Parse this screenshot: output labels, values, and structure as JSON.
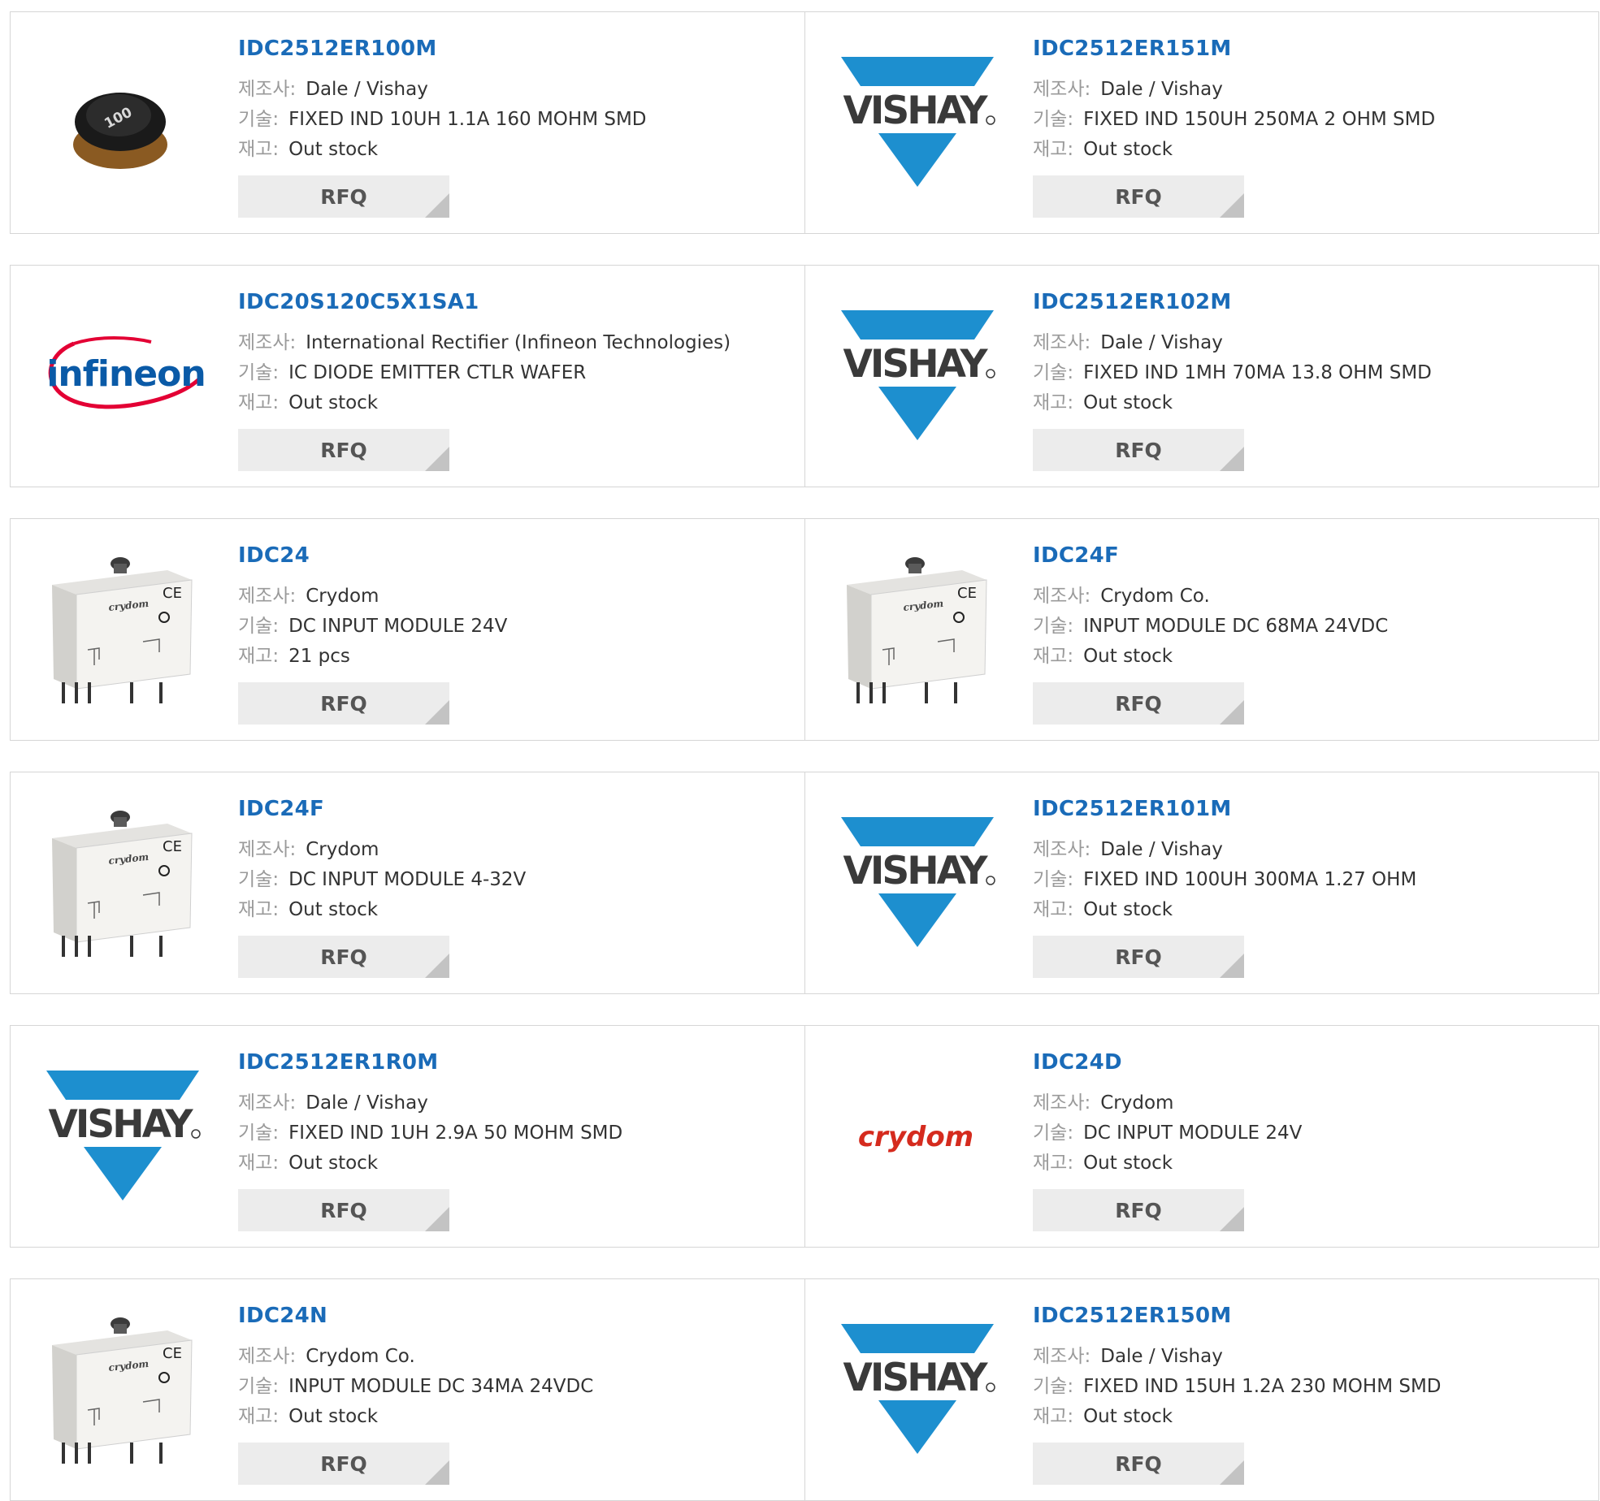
{
  "labels": {
    "manufacturer": "제조사:",
    "description": "기술:",
    "stock": "재고:"
  },
  "rfq_label": "RFQ",
  "colors": {
    "part_link": "#1a6bb8",
    "vishay_blue": "#1d8fcf",
    "crydom_red": "#d52b1e",
    "infineon_red": "#e30034",
    "infineon_blue": "#0a5aa7"
  },
  "products": [
    {
      "part": "IDC2512ER100M",
      "manufacturer": "Dale / Vishay",
      "description": "FIXED IND 10UH 1.1A 160 MOHM SMD",
      "stock": "Out stock",
      "image": "inductor-photo",
      "marking": "100"
    },
    {
      "part": "IDC2512ER151M",
      "manufacturer": "Dale / Vishay",
      "description": "FIXED IND 150UH 250MA 2 OHM SMD",
      "stock": "Out stock",
      "image": "vishay-logo",
      "logo_text": "VISHAY"
    },
    {
      "part": "IDC20S120C5X1SA1",
      "manufacturer": "International Rectifier (Infineon Technologies)",
      "description": "IC DIODE EMITTER CTLR WAFER",
      "stock": "Out stock",
      "image": "infineon-logo",
      "logo_text": "infineon"
    },
    {
      "part": "IDC2512ER102M",
      "manufacturer": "Dale / Vishay",
      "description": "FIXED IND 1MH 70MA 13.8 OHM SMD",
      "stock": "Out stock",
      "image": "vishay-logo",
      "logo_text": "VISHAY"
    },
    {
      "part": "IDC24",
      "manufacturer": "Crydom",
      "description": "DC INPUT MODULE 24V",
      "stock": "21 pcs",
      "image": "crydom-module-photo",
      "logo_text": "crydom"
    },
    {
      "part": "IDC24F",
      "manufacturer": "Crydom Co.",
      "description": "INPUT MODULE DC 68MA 24VDC",
      "stock": "Out stock",
      "image": "crydom-module-photo",
      "logo_text": "crydom"
    },
    {
      "part": "IDC24F",
      "manufacturer": "Crydom",
      "description": "DC INPUT MODULE 4-32V",
      "stock": "Out stock",
      "image": "crydom-module-photo",
      "logo_text": "crydom"
    },
    {
      "part": "IDC2512ER101M",
      "manufacturer": "Dale / Vishay",
      "description": "FIXED IND 100UH 300MA 1.27 OHM",
      "stock": "Out stock",
      "image": "vishay-logo",
      "logo_text": "VISHAY"
    },
    {
      "part": "IDC2512ER1R0M",
      "manufacturer": "Dale / Vishay",
      "description": "FIXED IND 1UH 2.9A 50 MOHM SMD",
      "stock": "Out stock",
      "image": "vishay-logo",
      "logo_text": "VISHAY"
    },
    {
      "part": "IDC24D",
      "manufacturer": "Crydom",
      "description": "DC INPUT MODULE 24V",
      "stock": "Out stock",
      "image": "crydom-logo",
      "logo_text": "crydom"
    },
    {
      "part": "IDC24N",
      "manufacturer": "Crydom Co.",
      "description": "INPUT MODULE DC 34MA 24VDC",
      "stock": "Out stock",
      "image": "crydom-module-photo",
      "logo_text": "crydom"
    },
    {
      "part": "IDC2512ER150M",
      "manufacturer": "Dale / Vishay",
      "description": "FIXED IND 15UH 1.2A 230 MOHM SMD",
      "stock": "Out stock",
      "image": "vishay-logo",
      "logo_text": "VISHAY"
    }
  ]
}
